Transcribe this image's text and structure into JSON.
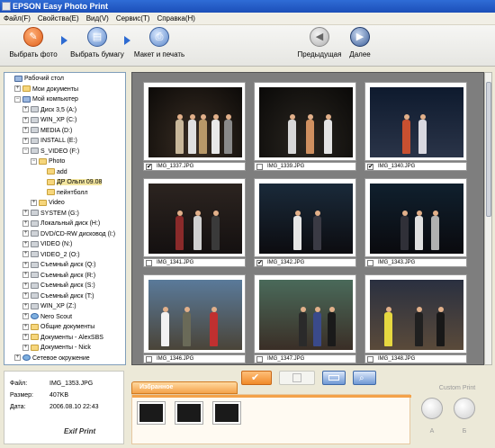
{
  "window": {
    "title": "EPSON Easy Photo Print"
  },
  "menu": [
    "Файл(F)",
    "Свойства(E)",
    "Вид(V)",
    "Сервис(T)",
    "Справка(H)"
  ],
  "toolbar": {
    "select_photo": "Выбрать фото",
    "select_paper": "Выбрать бумагу",
    "layout_print": "Макет и печать",
    "previous": "Предыдущая",
    "next": "Далее"
  },
  "tree": [
    {
      "label": "Рабочий стол",
      "indent": 0,
      "icon": "desktop-icon",
      "exp": ""
    },
    {
      "label": "Мои документы",
      "indent": 1,
      "icon": "folder-icon",
      "exp": "+"
    },
    {
      "label": "Мой компьютер",
      "indent": 1,
      "icon": "computer-icon",
      "exp": "−"
    },
    {
      "label": "Диск 3,5 (A:)",
      "indent": 2,
      "icon": "drive-icon",
      "exp": "+"
    },
    {
      "label": "WIN_XP (C:)",
      "indent": 2,
      "icon": "drive-icon",
      "exp": "+"
    },
    {
      "label": "MEDIA (D:)",
      "indent": 2,
      "icon": "drive-icon",
      "exp": "+"
    },
    {
      "label": "INSTALL (E:)",
      "indent": 2,
      "icon": "drive-icon",
      "exp": "+"
    },
    {
      "label": "S_VIDEO (F:)",
      "indent": 2,
      "icon": "drive-icon",
      "exp": "−"
    },
    {
      "label": "Photo",
      "indent": 3,
      "icon": "folder-icon",
      "exp": "−"
    },
    {
      "label": "add",
      "indent": 4,
      "icon": "folder-icon",
      "exp": ""
    },
    {
      "label": "ДР Ольги 09.08",
      "indent": 4,
      "icon": "folder-icon",
      "exp": "",
      "selected": true
    },
    {
      "label": "пейнтболл",
      "indent": 4,
      "icon": "folder-icon",
      "exp": ""
    },
    {
      "label": "Video",
      "indent": 3,
      "icon": "folder-icon",
      "exp": "+"
    },
    {
      "label": "SYSTEM (G:)",
      "indent": 2,
      "icon": "drive-icon",
      "exp": "+"
    },
    {
      "label": "Локальный диск (H:)",
      "indent": 2,
      "icon": "drive-icon",
      "exp": "+"
    },
    {
      "label": "DVD/CD-RW дисковод (I:)",
      "indent": 2,
      "icon": "drive-icon",
      "exp": "+"
    },
    {
      "label": "VIDEO (N:)",
      "indent": 2,
      "icon": "drive-icon",
      "exp": "+"
    },
    {
      "label": "VIDEO_2 (O:)",
      "indent": 2,
      "icon": "drive-icon",
      "exp": "+"
    },
    {
      "label": "Съемный диск (Q:)",
      "indent": 2,
      "icon": "drive-icon",
      "exp": "+"
    },
    {
      "label": "Съемный диск (R:)",
      "indent": 2,
      "icon": "drive-icon",
      "exp": "+"
    },
    {
      "label": "Съемный диск (S:)",
      "indent": 2,
      "icon": "drive-icon",
      "exp": "+"
    },
    {
      "label": "Съемный диск (T:)",
      "indent": 2,
      "icon": "drive-icon",
      "exp": "+"
    },
    {
      "label": "WIN_XP (Z:)",
      "indent": 2,
      "icon": "drive-icon",
      "exp": "+"
    },
    {
      "label": "Nero Scout",
      "indent": 2,
      "icon": "network-icon",
      "exp": "+"
    },
    {
      "label": "Общие документы",
      "indent": 2,
      "icon": "folder-icon",
      "exp": "+"
    },
    {
      "label": "Документы - AlexSBS",
      "indent": 2,
      "icon": "folder-icon",
      "exp": "+"
    },
    {
      "label": "Документы - Nick",
      "indent": 2,
      "icon": "folder-icon",
      "exp": "+"
    },
    {
      "label": "Сетевое окружение",
      "indent": 1,
      "icon": "network-icon",
      "exp": "+"
    }
  ],
  "photos": [
    {
      "name": "IMG_1337.JPG",
      "checked": true
    },
    {
      "name": "IMG_1339.JPG",
      "checked": false
    },
    {
      "name": "IMG_1340.JPG",
      "checked": true
    },
    {
      "name": "IMG_1341.JPG",
      "checked": false
    },
    {
      "name": "IMG_1342.JPG",
      "checked": true
    },
    {
      "name": "IMG_1343.JPG",
      "checked": false
    },
    {
      "name": "IMG_1346.JPG",
      "checked": false
    },
    {
      "name": "IMG_1347.JPG",
      "checked": false
    },
    {
      "name": "IMG_1348.JPG",
      "checked": false
    }
  ],
  "info": {
    "file_label": "Файл:",
    "file_value": "IMG_1353.JPG",
    "size_label": "Размер:",
    "size_value": "407KB",
    "date_label": "Дата:",
    "date_value": "2006.08.10 22:43",
    "exif": "Exif Print"
  },
  "favorites": {
    "tab": "Избранное",
    "thumb_count": 3
  },
  "custom_print": {
    "title": "Custom Print",
    "a": "А",
    "b": "Б"
  },
  "colors": {
    "accent": "#f4a24a",
    "title_blue": "#1c4fb8",
    "selection": "#f3e6a0"
  }
}
